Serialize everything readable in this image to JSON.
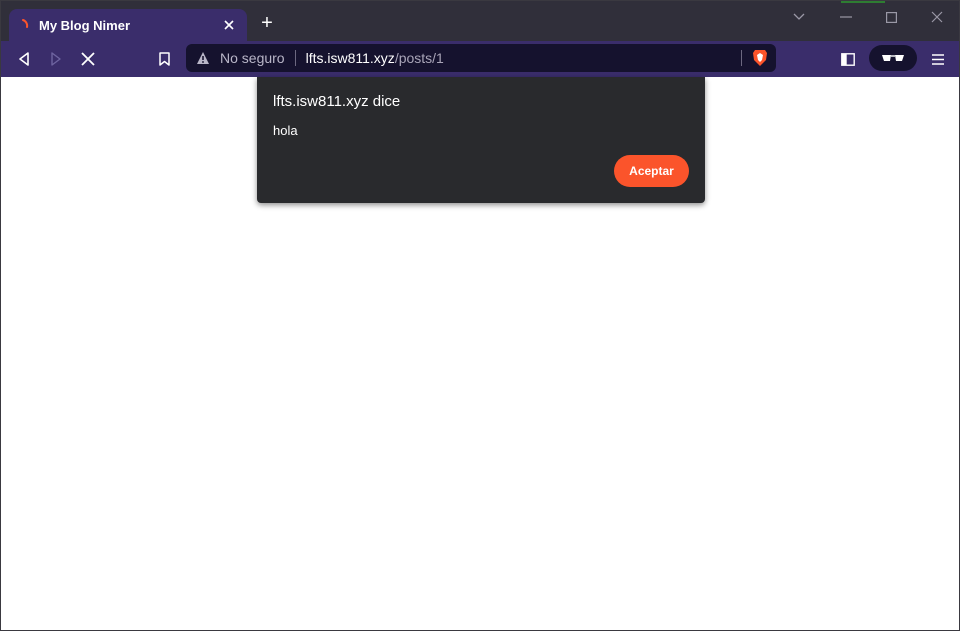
{
  "tab": {
    "title": "My Blog Nimer",
    "spinner_icon": "loading-spinner-icon",
    "close_icon": "close-icon"
  },
  "tabstrip": {
    "new_tab_label": "+",
    "window_controls": [
      "chevron-down-icon",
      "minimize-icon",
      "maximize-icon",
      "close-icon"
    ]
  },
  "toolbar": {
    "icons": [
      "back-icon",
      "forward-icon",
      "stop-icon",
      "bookmark-icon",
      "sidebar-icon",
      "glasses-icon",
      "menu-icon"
    ]
  },
  "address_bar": {
    "security_label": "No seguro",
    "host": "lfts.isw811.xyz",
    "path": "/posts/1",
    "shield_icon": "brave-shield-icon"
  },
  "dialog": {
    "title": "lfts.isw811.xyz dice",
    "message": "hola",
    "accept_label": "Aceptar"
  },
  "colors": {
    "accent": "#fb542b",
    "toolbar": "#3a2d6b",
    "dialog_bg": "#292a2d"
  }
}
